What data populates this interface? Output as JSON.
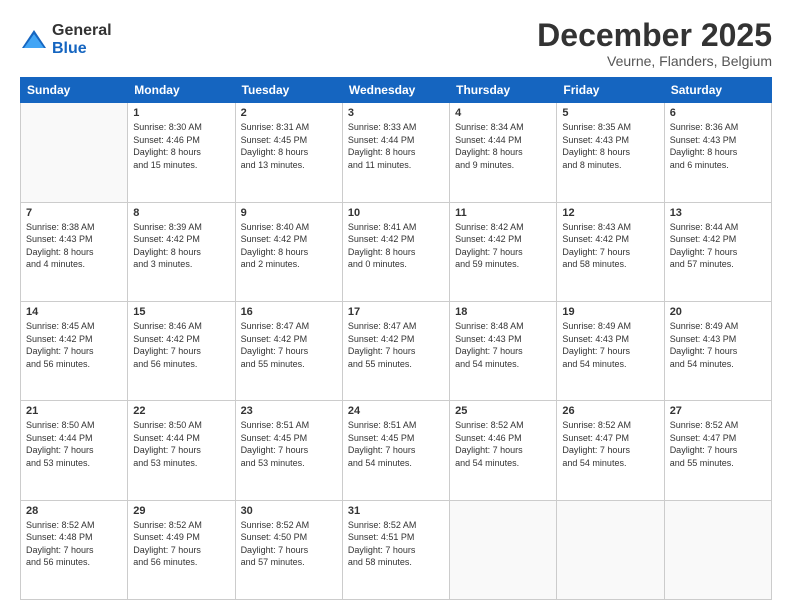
{
  "logo": {
    "general": "General",
    "blue": "Blue"
  },
  "header": {
    "month": "December 2025",
    "location": "Veurne, Flanders, Belgium"
  },
  "days_header": [
    "Sunday",
    "Monday",
    "Tuesday",
    "Wednesday",
    "Thursday",
    "Friday",
    "Saturday"
  ],
  "weeks": [
    [
      {
        "day": "",
        "info": ""
      },
      {
        "day": "1",
        "info": "Sunrise: 8:30 AM\nSunset: 4:46 PM\nDaylight: 8 hours\nand 15 minutes."
      },
      {
        "day": "2",
        "info": "Sunrise: 8:31 AM\nSunset: 4:45 PM\nDaylight: 8 hours\nand 13 minutes."
      },
      {
        "day": "3",
        "info": "Sunrise: 8:33 AM\nSunset: 4:44 PM\nDaylight: 8 hours\nand 11 minutes."
      },
      {
        "day": "4",
        "info": "Sunrise: 8:34 AM\nSunset: 4:44 PM\nDaylight: 8 hours\nand 9 minutes."
      },
      {
        "day": "5",
        "info": "Sunrise: 8:35 AM\nSunset: 4:43 PM\nDaylight: 8 hours\nand 8 minutes."
      },
      {
        "day": "6",
        "info": "Sunrise: 8:36 AM\nSunset: 4:43 PM\nDaylight: 8 hours\nand 6 minutes."
      }
    ],
    [
      {
        "day": "7",
        "info": "Sunrise: 8:38 AM\nSunset: 4:43 PM\nDaylight: 8 hours\nand 4 minutes."
      },
      {
        "day": "8",
        "info": "Sunrise: 8:39 AM\nSunset: 4:42 PM\nDaylight: 8 hours\nand 3 minutes."
      },
      {
        "day": "9",
        "info": "Sunrise: 8:40 AM\nSunset: 4:42 PM\nDaylight: 8 hours\nand 2 minutes."
      },
      {
        "day": "10",
        "info": "Sunrise: 8:41 AM\nSunset: 4:42 PM\nDaylight: 8 hours\nand 0 minutes."
      },
      {
        "day": "11",
        "info": "Sunrise: 8:42 AM\nSunset: 4:42 PM\nDaylight: 7 hours\nand 59 minutes."
      },
      {
        "day": "12",
        "info": "Sunrise: 8:43 AM\nSunset: 4:42 PM\nDaylight: 7 hours\nand 58 minutes."
      },
      {
        "day": "13",
        "info": "Sunrise: 8:44 AM\nSunset: 4:42 PM\nDaylight: 7 hours\nand 57 minutes."
      }
    ],
    [
      {
        "day": "14",
        "info": "Sunrise: 8:45 AM\nSunset: 4:42 PM\nDaylight: 7 hours\nand 56 minutes."
      },
      {
        "day": "15",
        "info": "Sunrise: 8:46 AM\nSunset: 4:42 PM\nDaylight: 7 hours\nand 56 minutes."
      },
      {
        "day": "16",
        "info": "Sunrise: 8:47 AM\nSunset: 4:42 PM\nDaylight: 7 hours\nand 55 minutes."
      },
      {
        "day": "17",
        "info": "Sunrise: 8:47 AM\nSunset: 4:42 PM\nDaylight: 7 hours\nand 55 minutes."
      },
      {
        "day": "18",
        "info": "Sunrise: 8:48 AM\nSunset: 4:43 PM\nDaylight: 7 hours\nand 54 minutes."
      },
      {
        "day": "19",
        "info": "Sunrise: 8:49 AM\nSunset: 4:43 PM\nDaylight: 7 hours\nand 54 minutes."
      },
      {
        "day": "20",
        "info": "Sunrise: 8:49 AM\nSunset: 4:43 PM\nDaylight: 7 hours\nand 54 minutes."
      }
    ],
    [
      {
        "day": "21",
        "info": "Sunrise: 8:50 AM\nSunset: 4:44 PM\nDaylight: 7 hours\nand 53 minutes."
      },
      {
        "day": "22",
        "info": "Sunrise: 8:50 AM\nSunset: 4:44 PM\nDaylight: 7 hours\nand 53 minutes."
      },
      {
        "day": "23",
        "info": "Sunrise: 8:51 AM\nSunset: 4:45 PM\nDaylight: 7 hours\nand 53 minutes."
      },
      {
        "day": "24",
        "info": "Sunrise: 8:51 AM\nSunset: 4:45 PM\nDaylight: 7 hours\nand 54 minutes."
      },
      {
        "day": "25",
        "info": "Sunrise: 8:52 AM\nSunset: 4:46 PM\nDaylight: 7 hours\nand 54 minutes."
      },
      {
        "day": "26",
        "info": "Sunrise: 8:52 AM\nSunset: 4:47 PM\nDaylight: 7 hours\nand 54 minutes."
      },
      {
        "day": "27",
        "info": "Sunrise: 8:52 AM\nSunset: 4:47 PM\nDaylight: 7 hours\nand 55 minutes."
      }
    ],
    [
      {
        "day": "28",
        "info": "Sunrise: 8:52 AM\nSunset: 4:48 PM\nDaylight: 7 hours\nand 56 minutes."
      },
      {
        "day": "29",
        "info": "Sunrise: 8:52 AM\nSunset: 4:49 PM\nDaylight: 7 hours\nand 56 minutes."
      },
      {
        "day": "30",
        "info": "Sunrise: 8:52 AM\nSunset: 4:50 PM\nDaylight: 7 hours\nand 57 minutes."
      },
      {
        "day": "31",
        "info": "Sunrise: 8:52 AM\nSunset: 4:51 PM\nDaylight: 7 hours\nand 58 minutes."
      },
      {
        "day": "",
        "info": ""
      },
      {
        "day": "",
        "info": ""
      },
      {
        "day": "",
        "info": ""
      }
    ]
  ]
}
